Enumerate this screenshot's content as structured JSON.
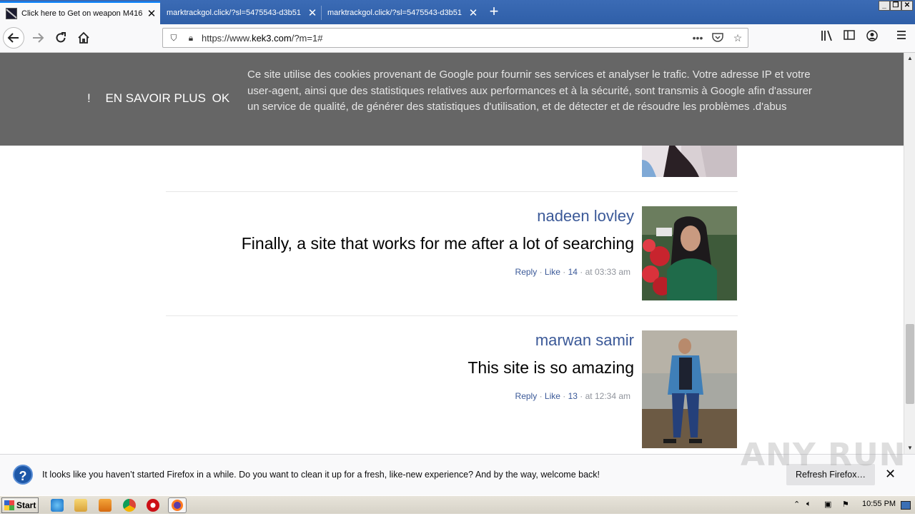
{
  "browser": {
    "tabs": [
      {
        "title": "Click here to Get on weapon M416",
        "active": true
      },
      {
        "title": "marktrackgol.click/?sl=5475543-d3b51",
        "active": false
      },
      {
        "title": "marktrackgol.click/?sl=5475543-d3b51",
        "active": false
      }
    ],
    "url_prefix": "https://www.",
    "url_domain": "kek3.com",
    "url_path": "/?m=1#",
    "icons": [
      "back-icon",
      "forward-icon",
      "reload-icon",
      "home-icon",
      "shield-icon",
      "lock-icon",
      "more-icon",
      "pocket-icon",
      "star-icon",
      "library-icon",
      "sidebar-icon",
      "account-icon",
      "menu-icon"
    ]
  },
  "cookie_banner": {
    "exclaim": "!",
    "learn_more": "EN SAVOIR PLUS",
    "ok": "OK",
    "message": "Ce site utilise des cookies provenant de Google pour fournir ses services et analyser le trafic. Votre adresse IP et votre user-agent, ainsi que des statistiques relatives aux performances et à la sécurité, sont transmis à Google afin d'assurer un service de qualité, de générer des statistiques d'utilisation, et de détecter et de résoudre les problèmes .d'abus"
  },
  "comments": [
    {
      "name": "nadeen lovley",
      "text": "Finally, a site that works for me after a lot of searching",
      "reply": "Reply",
      "like": "Like",
      "likes": "14",
      "time": "at 03:33 am"
    },
    {
      "name": "marwan samir",
      "text": "This site is so amazing",
      "reply": "Reply",
      "like": "Like",
      "likes": "13",
      "time": "at 12:34 am"
    }
  ],
  "notification": {
    "text": "It looks like you haven’t started Firefox in a while. Do you want to clean it up for a fresh, like-new experience? And by the way, welcome back!",
    "button": "Refresh Firefox…",
    "close": "✕"
  },
  "watermark": "ANY RUN",
  "taskbar": {
    "start": "Start",
    "clock": "10:55 PM"
  }
}
